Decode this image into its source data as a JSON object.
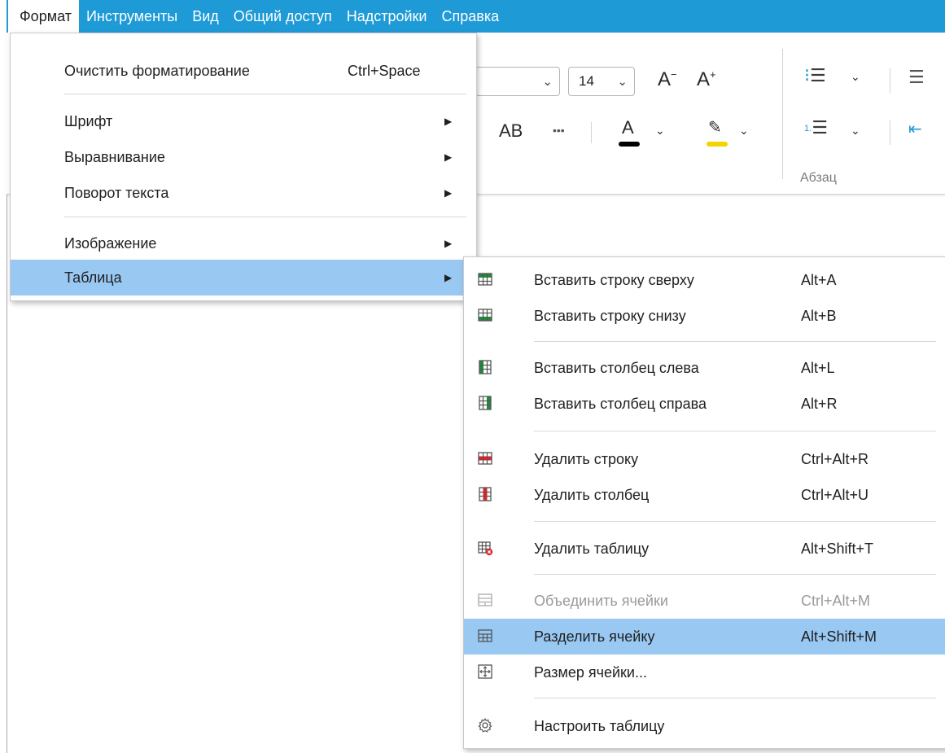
{
  "menubar": {
    "items": [
      "Формат",
      "Инструменты",
      "Вид",
      "Общий доступ",
      "Надстройки",
      "Справка"
    ],
    "active_index": 0
  },
  "toolbar": {
    "font_size": "14",
    "case_label": "AB",
    "more": "•••",
    "font_color_glyph": "A",
    "decrease_font": "A",
    "increase_font": "A",
    "paragraph_group": "Абзац",
    "colors": {
      "font_color_bar": "#000000",
      "highlight_bar": "#f5d300"
    }
  },
  "format_menu": {
    "items": [
      {
        "label": "Очистить форматирование",
        "shortcut": "Ctrl+Space"
      },
      {
        "label": "Шрифт"
      },
      {
        "label": "Выравнивание"
      },
      {
        "label": "Поворот текста"
      },
      {
        "label": "Изображение"
      },
      {
        "label": "Таблица"
      }
    ],
    "highlighted_index": 5
  },
  "table_menu": {
    "items": [
      {
        "label": "Вставить строку сверху",
        "shortcut": "Alt+A",
        "icon": "insert-row-above-icon"
      },
      {
        "label": "Вставить строку снизу",
        "shortcut": "Alt+B",
        "icon": "insert-row-below-icon"
      },
      {
        "label": "Вставить столбец слева",
        "shortcut": "Alt+L",
        "icon": "insert-column-left-icon"
      },
      {
        "label": "Вставить столбец справа",
        "shortcut": "Alt+R",
        "icon": "insert-column-right-icon"
      },
      {
        "label": "Удалить строку",
        "shortcut": "Ctrl+Alt+R",
        "icon": "delete-row-icon"
      },
      {
        "label": "Удалить столбец",
        "shortcut": "Ctrl+Alt+U",
        "icon": "delete-column-icon"
      },
      {
        "label": "Удалить таблицу",
        "shortcut": "Alt+Shift+T",
        "icon": "delete-table-icon"
      },
      {
        "label": "Объединить ячейки",
        "shortcut": "Ctrl+Alt+M",
        "icon": "merge-cells-icon",
        "disabled": true
      },
      {
        "label": "Разделить ячейку",
        "shortcut": "Alt+Shift+M",
        "icon": "split-cell-icon"
      },
      {
        "label": "Размер ячейки...",
        "shortcut": "",
        "icon": "cell-size-icon"
      },
      {
        "label": "Настроить таблицу",
        "shortcut": "",
        "icon": "table-settings-gear-icon"
      }
    ],
    "highlighted_index": 8
  },
  "colors": {
    "menubar": "#1e9ad6",
    "highlight": "#99c9f3",
    "icon_green": "#1f8a3b",
    "icon_red": "#d8262c"
  }
}
